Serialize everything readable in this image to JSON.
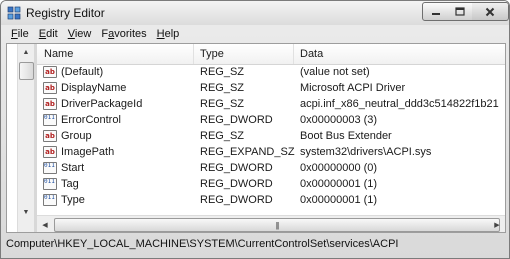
{
  "window": {
    "title": "Registry Editor"
  },
  "menu": [
    {
      "hot": "F",
      "rest": "ile"
    },
    {
      "hot": "E",
      "rest": "dit"
    },
    {
      "hot": "V",
      "rest": "iew"
    },
    {
      "pre": "F",
      "hot": "a",
      "rest": "vorites"
    },
    {
      "hot": "H",
      "rest": "elp"
    }
  ],
  "columns": {
    "name": "Name",
    "type": "Type",
    "data": "Data"
  },
  "rows": [
    {
      "icon": "string-value-icon",
      "name": "(Default)",
      "type": "REG_SZ",
      "data": "(value not set)"
    },
    {
      "icon": "string-value-icon",
      "name": "DisplayName",
      "type": "REG_SZ",
      "data": "Microsoft ACPI Driver"
    },
    {
      "icon": "string-value-icon",
      "name": "DriverPackageId",
      "type": "REG_SZ",
      "data": "acpi.inf_x86_neutral_ddd3c514822f1b21"
    },
    {
      "icon": "binary-value-icon",
      "name": "ErrorControl",
      "type": "REG_DWORD",
      "data": "0x00000003 (3)"
    },
    {
      "icon": "string-value-icon",
      "name": "Group",
      "type": "REG_SZ",
      "data": "Boot Bus Extender"
    },
    {
      "icon": "string-value-icon",
      "name": "ImagePath",
      "type": "REG_EXPAND_SZ",
      "data": "system32\\drivers\\ACPI.sys"
    },
    {
      "icon": "binary-value-icon",
      "name": "Start",
      "type": "REG_DWORD",
      "data": "0x00000000 (0)"
    },
    {
      "icon": "binary-value-icon",
      "name": "Tag",
      "type": "REG_DWORD",
      "data": "0x00000001 (1)"
    },
    {
      "icon": "binary-value-icon",
      "name": "Type",
      "type": "REG_DWORD",
      "data": "0x00000001 (1)"
    }
  ],
  "status": {
    "path": "Computer\\HKEY_LOCAL_MACHINE\\SYSTEM\\CurrentControlSet\\services\\ACPI"
  }
}
